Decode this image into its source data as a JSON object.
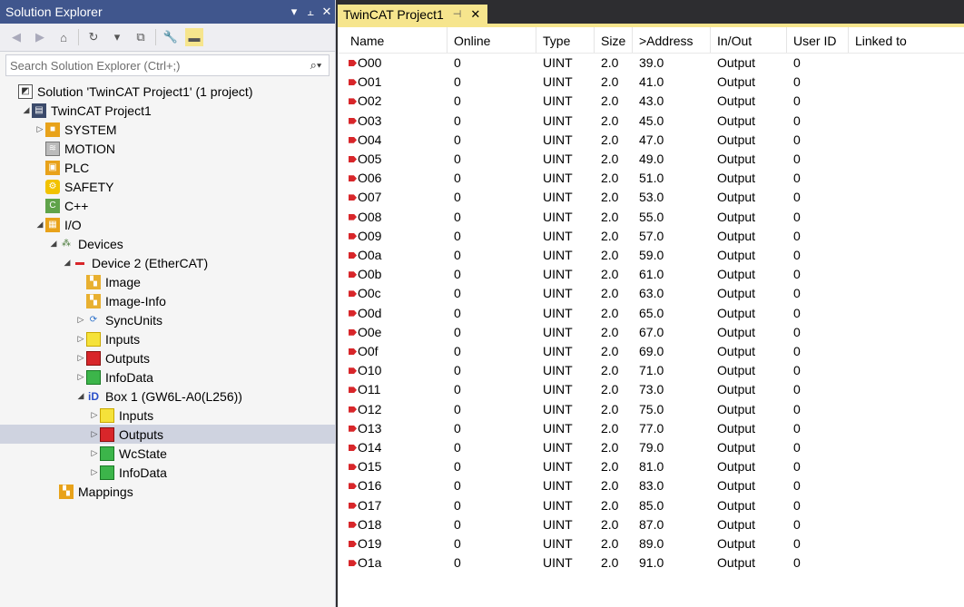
{
  "explorer": {
    "title": "Solution Explorer",
    "title_controls": [
      "▾",
      "⫠",
      "✕"
    ],
    "search_placeholder": "Search Solution Explorer (Ctrl+;)",
    "tree": [
      {
        "label": "Solution 'TwinCAT Project1' (1 project)",
        "depth": 0,
        "arrow": "",
        "icon": "solution-icon"
      },
      {
        "label": "TwinCAT Project1",
        "depth": 1,
        "arrow": "◢",
        "icon": "project-icon"
      },
      {
        "label": "SYSTEM",
        "depth": 2,
        "arrow": "▷",
        "icon": "system-icon"
      },
      {
        "label": "MOTION",
        "depth": 2,
        "arrow": "",
        "icon": "motion-icon"
      },
      {
        "label": "PLC",
        "depth": 2,
        "arrow": "",
        "icon": "plc-icon"
      },
      {
        "label": "SAFETY",
        "depth": 2,
        "arrow": "",
        "icon": "safety-icon"
      },
      {
        "label": "C++",
        "depth": 2,
        "arrow": "",
        "icon": "cpp-icon"
      },
      {
        "label": "I/O",
        "depth": 2,
        "arrow": "◢",
        "icon": "io-icon"
      },
      {
        "label": "Devices",
        "depth": 3,
        "arrow": "◢",
        "icon": "devices-icon"
      },
      {
        "label": "Device 2 (EtherCAT)",
        "depth": 4,
        "arrow": "◢",
        "icon": "ethercat-icon"
      },
      {
        "label": "Image",
        "depth": 5,
        "arrow": "",
        "icon": "image-icon"
      },
      {
        "label": "Image-Info",
        "depth": 5,
        "arrow": "",
        "icon": "image-info-icon"
      },
      {
        "label": "SyncUnits",
        "depth": 5,
        "arrow": "▷",
        "icon": "syncunits-icon"
      },
      {
        "label": "Inputs",
        "depth": 5,
        "arrow": "▷",
        "icon": "inputs-icon"
      },
      {
        "label": "Outputs",
        "depth": 5,
        "arrow": "▷",
        "icon": "outputs-icon"
      },
      {
        "label": "InfoData",
        "depth": 5,
        "arrow": "▷",
        "icon": "infodata-icon"
      },
      {
        "label": "Box 1 (GW6L-A0(L256))",
        "depth": 5,
        "arrow": "◢",
        "icon": "box-icon"
      },
      {
        "label": "Inputs",
        "depth": 6,
        "arrow": "▷",
        "icon": "inputs-icon"
      },
      {
        "label": "Outputs",
        "depth": 6,
        "arrow": "▷",
        "icon": "outputs-icon",
        "selected": true
      },
      {
        "label": "WcState",
        "depth": 6,
        "arrow": "▷",
        "icon": "wcstate-icon"
      },
      {
        "label": "InfoData",
        "depth": 6,
        "arrow": "▷",
        "icon": "infodata-icon"
      },
      {
        "label": "Mappings",
        "depth": 3,
        "arrow": "",
        "icon": "mappings-icon"
      }
    ]
  },
  "tab": {
    "label": "TwinCAT Project1",
    "pin": "⊣",
    "close": "✕"
  },
  "table": {
    "columns": [
      "Name",
      "Online",
      "Type",
      "Size",
      ">Address",
      "In/Out",
      "User ID",
      "Linked to"
    ],
    "rows": [
      [
        "O00",
        "0",
        "UINT",
        "2.0",
        "39.0",
        "Output",
        "0"
      ],
      [
        "O01",
        "0",
        "UINT",
        "2.0",
        "41.0",
        "Output",
        "0"
      ],
      [
        "O02",
        "0",
        "UINT",
        "2.0",
        "43.0",
        "Output",
        "0"
      ],
      [
        "O03",
        "0",
        "UINT",
        "2.0",
        "45.0",
        "Output",
        "0"
      ],
      [
        "O04",
        "0",
        "UINT",
        "2.0",
        "47.0",
        "Output",
        "0"
      ],
      [
        "O05",
        "0",
        "UINT",
        "2.0",
        "49.0",
        "Output",
        "0"
      ],
      [
        "O06",
        "0",
        "UINT",
        "2.0",
        "51.0",
        "Output",
        "0"
      ],
      [
        "O07",
        "0",
        "UINT",
        "2.0",
        "53.0",
        "Output",
        "0"
      ],
      [
        "O08",
        "0",
        "UINT",
        "2.0",
        "55.0",
        "Output",
        "0"
      ],
      [
        "O09",
        "0",
        "UINT",
        "2.0",
        "57.0",
        "Output",
        "0"
      ],
      [
        "O0a",
        "0",
        "UINT",
        "2.0",
        "59.0",
        "Output",
        "0"
      ],
      [
        "O0b",
        "0",
        "UINT",
        "2.0",
        "61.0",
        "Output",
        "0"
      ],
      [
        "O0c",
        "0",
        "UINT",
        "2.0",
        "63.0",
        "Output",
        "0"
      ],
      [
        "O0d",
        "0",
        "UINT",
        "2.0",
        "65.0",
        "Output",
        "0"
      ],
      [
        "O0e",
        "0",
        "UINT",
        "2.0",
        "67.0",
        "Output",
        "0"
      ],
      [
        "O0f",
        "0",
        "UINT",
        "2.0",
        "69.0",
        "Output",
        "0"
      ],
      [
        "O10",
        "0",
        "UINT",
        "2.0",
        "71.0",
        "Output",
        "0"
      ],
      [
        "O11",
        "0",
        "UINT",
        "2.0",
        "73.0",
        "Output",
        "0"
      ],
      [
        "O12",
        "0",
        "UINT",
        "2.0",
        "75.0",
        "Output",
        "0"
      ],
      [
        "O13",
        "0",
        "UINT",
        "2.0",
        "77.0",
        "Output",
        "0"
      ],
      [
        "O14",
        "0",
        "UINT",
        "2.0",
        "79.0",
        "Output",
        "0"
      ],
      [
        "O15",
        "0",
        "UINT",
        "2.0",
        "81.0",
        "Output",
        "0"
      ],
      [
        "O16",
        "0",
        "UINT",
        "2.0",
        "83.0",
        "Output",
        "0"
      ],
      [
        "O17",
        "0",
        "UINT",
        "2.0",
        "85.0",
        "Output",
        "0"
      ],
      [
        "O18",
        "0",
        "UINT",
        "2.0",
        "87.0",
        "Output",
        "0"
      ],
      [
        "O19",
        "0",
        "UINT",
        "2.0",
        "89.0",
        "Output",
        "0"
      ],
      [
        "O1a",
        "0",
        "UINT",
        "2.0",
        "91.0",
        "Output",
        "0"
      ]
    ]
  },
  "colors": {
    "title_bar": "#40568d",
    "tab_accent": "#f6e58d",
    "selection": "#cfd3e0",
    "output_tag": "#d8262a"
  }
}
